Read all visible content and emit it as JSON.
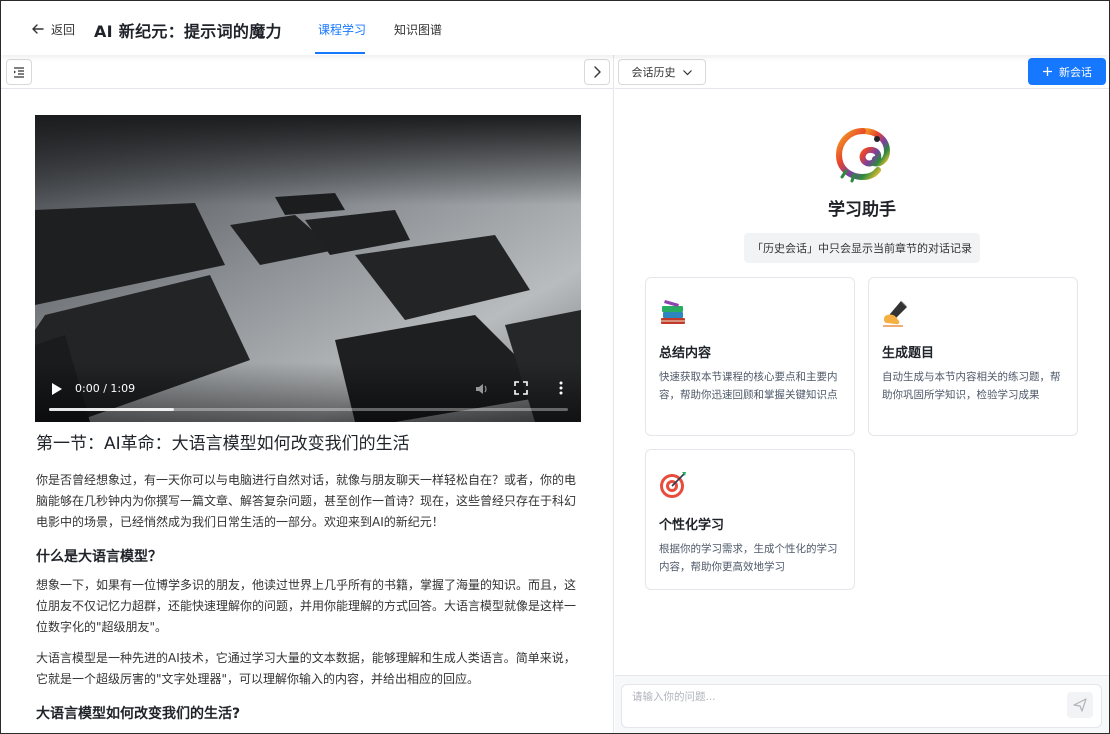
{
  "header": {
    "back_label": "返回",
    "course_title": "AI 新纪元：提示词的魔力",
    "tabs": [
      {
        "label": "课程学习",
        "active": true
      },
      {
        "label": "知识图谱",
        "active": false
      }
    ],
    "accent_color": "#1677ff"
  },
  "video": {
    "time_display": "0:00 / 1:09",
    "progress_fraction": 0.24
  },
  "article": {
    "section_title": "第一节：AI革命：大语言模型如何改变我们的生活",
    "intro": "你是否曾经想象过，有一天你可以与电脑进行自然对话，就像与朋友聊天一样轻松自在？或者，你的电脑能够在几秒钟内为你撰写一篇文章、解答复杂问题，甚至创作一首诗？现在，这些曾经只存在于科幻电影中的场景，已经悄然成为我们日常生活的一部分。欢迎来到AI的新纪元！",
    "heading_1": "什么是大语言模型？",
    "para_1": "想象一下，如果有一位博学多识的朋友，他读过世界上几乎所有的书籍，掌握了海量的知识。而且，这位朋友不仅记忆力超群，还能快速理解你的问题，并用你能理解的方式回答。大语言模型就像是这样一位数字化的\"超级朋友\"。",
    "para_2": "大语言模型是一种先进的AI技术，它通过学习大量的文本数据，能够理解和生成人类语言。简单来说，它就是一个超级厉害的\"文字处理器\"，可以理解你输入的内容，并给出相应的回应。",
    "heading_2": "大语言模型如何改变我们的生活?"
  },
  "assistant": {
    "history_button": "会话历史",
    "new_chat_button": "新会话",
    "title": "学习助手",
    "history_note": "「历史会话」中只会显示当前章节的对话记录",
    "cards": [
      {
        "icon": "books-icon",
        "title": "总结内容",
        "desc": "快速获取本节课程的核心要点和主要内容，帮助你迅速回顾和掌握关键知识点"
      },
      {
        "icon": "writing-hand-icon",
        "title": "生成题目",
        "desc": "自动生成与本节内容相关的练习题，帮助你巩固所学知识，检验学习成果"
      },
      {
        "icon": "target-icon",
        "title": "个性化学习",
        "desc": "根据你的学习需求，生成个性化的学习内容，帮助你更高效地学习"
      }
    ],
    "input_placeholder": "请输入你的问题..."
  }
}
